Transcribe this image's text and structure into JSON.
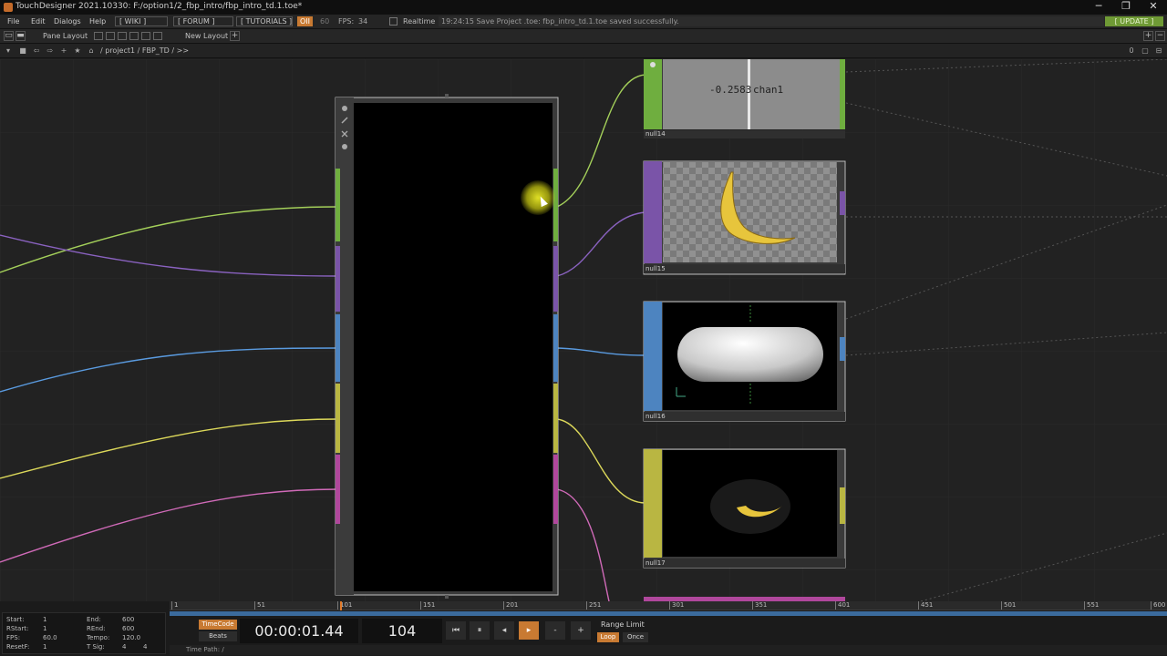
{
  "window": {
    "title": "TouchDesigner 2021.10330: F:/option1/2_fbp_intro/fbp_intro_td.1.toe*",
    "minimize": "─",
    "restore": "❐",
    "close": "✕"
  },
  "menu": {
    "items": [
      "File",
      "Edit",
      "Dialogs",
      "Help"
    ],
    "wiki": "[ WIKI ]",
    "forum": "[ FORUM ]",
    "tutorials": "[ TUTORIALS ]",
    "oii": "OII",
    "sixty": "60",
    "fps_label": "FPS:",
    "fps_value": "34",
    "realtime": "Realtime",
    "status_message": "19:24:15 Save Project .toe: fbp_intro_td.1.toe saved successfully.",
    "update": "[ UPDATE ]"
  },
  "panebar": {
    "pane_layout": "Pane Layout",
    "new_layout": "New Layout",
    "plus": "+",
    "right_icons": [
      "+",
      "−"
    ]
  },
  "pathbar": {
    "path": "/ project1 / FBP_TD / >>",
    "zero": "0"
  },
  "nodes": {
    "null14": {
      "label": "null14",
      "value": "-0.2583",
      "channel": "chan1",
      "color": "#6fae3f"
    },
    "null15": {
      "label": "null15",
      "color": "#7a54a8"
    },
    "null16": {
      "label": "null16",
      "color": "#4d84c0"
    },
    "null17": {
      "label": "null17",
      "color": "#b9b642"
    }
  },
  "colors": {
    "green": "#a4d05a",
    "purple": "#8a62c0",
    "blue": "#5a9be0",
    "yellow": "#dcd85a",
    "pink": "#d06ab8"
  },
  "timeline": {
    "ticks": [
      "1",
      "51",
      "101",
      "151",
      "201",
      "251",
      "301",
      "351",
      "401",
      "451",
      "501",
      "551",
      "600"
    ],
    "settings": {
      "start_label": "Start:",
      "start": "1",
      "end_label": "End:",
      "end": "600",
      "rstart_label": "RStart:",
      "rstart": "1",
      "rend_label": "REnd:",
      "rend": "600",
      "fps_label": "FPS:",
      "fps": "60.0",
      "tempo_label": "Tempo:",
      "tempo": "120.0",
      "resetf_label": "ResetF:",
      "resetf": "1",
      "tsig_label": "T Sig:",
      "tsig_a": "4",
      "tsig_b": "4"
    },
    "timecode_btn": "TimeCode",
    "beats_btn": "Beats",
    "timecode": "00:00:01.44",
    "frame": "104",
    "range_limit": "Range Limit",
    "loop": "Loop",
    "once": "Once",
    "time_path": "Time Path: /",
    "controls": {
      "rewind": "⏮",
      "pause": "⏸",
      "step_back": "◂",
      "play": "▸",
      "minus": "-",
      "plus": "+"
    }
  }
}
